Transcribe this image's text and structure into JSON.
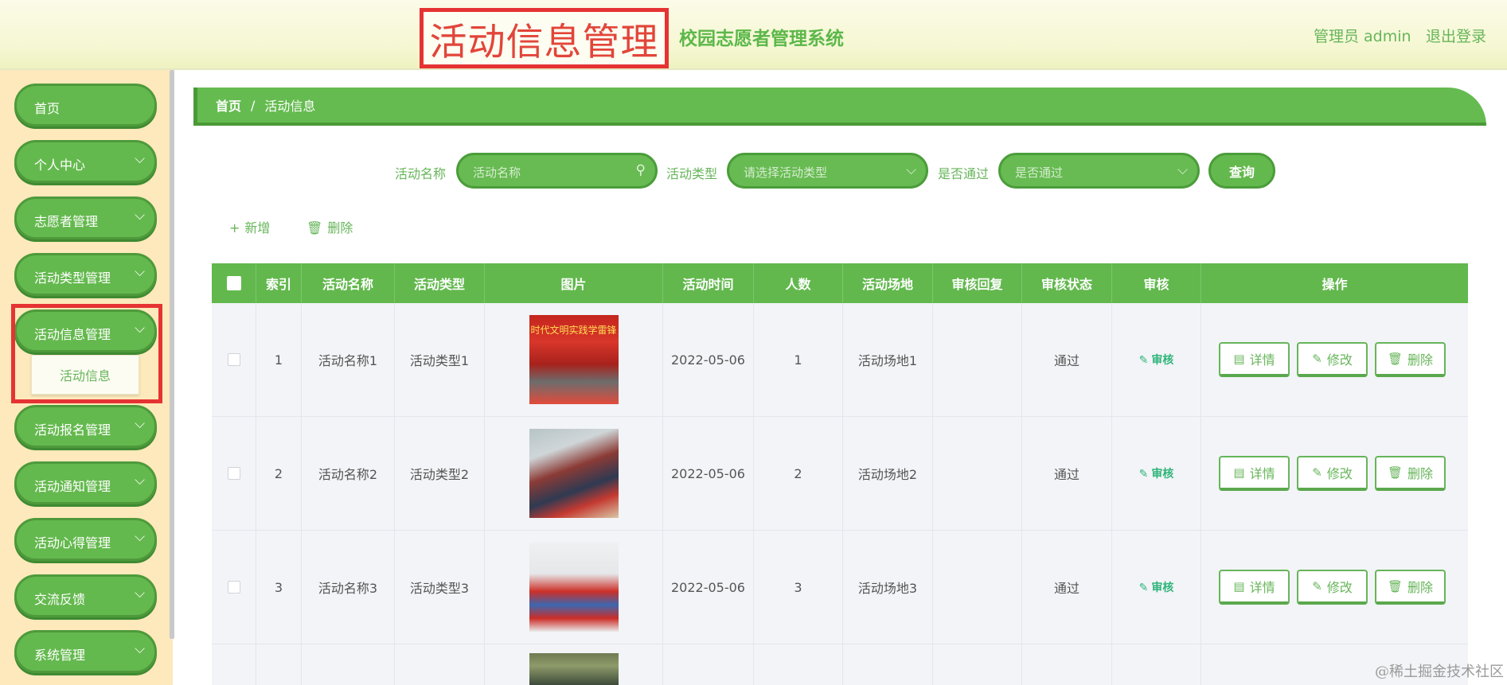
{
  "header": {
    "page_title": "活动信息管理",
    "system_name": "校园志愿者管理系统",
    "admin_label": "管理员 admin",
    "logout_label": "退出登录"
  },
  "sidebar": {
    "items": [
      {
        "label": "首页",
        "has_children": false
      },
      {
        "label": "个人中心",
        "has_children": true
      },
      {
        "label": "志愿者管理",
        "has_children": true
      },
      {
        "label": "活动类型管理",
        "has_children": true
      },
      {
        "label": "活动信息管理",
        "has_children": true,
        "expanded": true
      },
      {
        "label": "活动报名管理",
        "has_children": true
      },
      {
        "label": "活动通知管理",
        "has_children": true
      },
      {
        "label": "活动心得管理",
        "has_children": true
      },
      {
        "label": "交流反馈",
        "has_children": true
      },
      {
        "label": "系统管理",
        "has_children": true
      }
    ],
    "submenu": {
      "label": "活动信息"
    }
  },
  "breadcrumb": {
    "home": "首页",
    "separator": "/",
    "current": "活动信息"
  },
  "search": {
    "name_label": "活动名称",
    "name_placeholder": "活动名称",
    "type_label": "活动类型",
    "type_placeholder": "请选择活动类型",
    "passed_label": "是否通过",
    "passed_placeholder": "是否通过",
    "query_button": "查询"
  },
  "toolbar": {
    "add_label": "新增",
    "delete_label": "删除"
  },
  "table": {
    "columns": [
      "索引",
      "活动名称",
      "活动类型",
      "图片",
      "活动时间",
      "人数",
      "活动场地",
      "审核回复",
      "审核状态",
      "审核",
      "操作"
    ],
    "rows": [
      {
        "index": "1",
        "name": "活动名称1",
        "type": "活动类型1",
        "image": "photo-volunteers-ceremony",
        "image_text": "时代文明实践学雷锋",
        "time": "2022-05-06",
        "count": "1",
        "venue": "活动场地1",
        "reply": "",
        "status": "通过"
      },
      {
        "index": "2",
        "name": "活动名称2",
        "type": "活动类型2",
        "image": "photo-volunteers-delivery",
        "image_text": "",
        "time": "2022-05-06",
        "count": "2",
        "venue": "活动场地2",
        "reply": "",
        "status": "通过"
      },
      {
        "index": "3",
        "name": "活动名称3",
        "type": "活动类型3",
        "image": "photo-volunteers-group",
        "image_text": "",
        "time": "2022-05-06",
        "count": "3",
        "venue": "活动场地3",
        "reply": "",
        "status": "通过"
      }
    ],
    "audit_label": "审核",
    "detail_label": "详情",
    "edit_label": "修改",
    "delete_label": "删除"
  },
  "watermark": "@稀土掘金技术社区",
  "colors": {
    "primary": "#64b94e",
    "primary_dark": "#4b9d3a",
    "sidebar_bg": "#fde9bb",
    "highlight": "#e53333",
    "audit": "#2fb47a"
  }
}
